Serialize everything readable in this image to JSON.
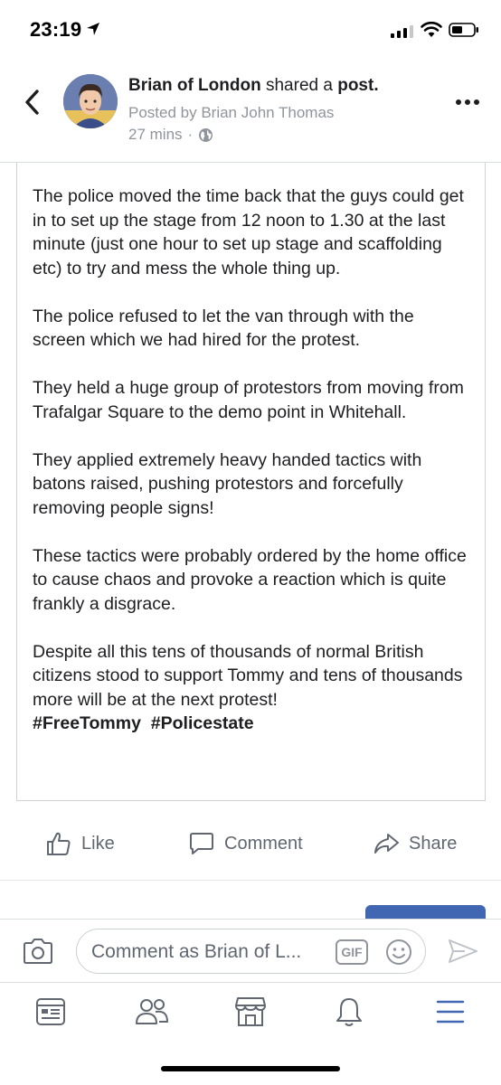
{
  "status_bar": {
    "time": "23:19"
  },
  "header": {
    "author": "Brian of London",
    "shared_text": "shared a",
    "post_word": "post.",
    "posted_by": "Posted by Brian John Thomas",
    "time_ago": "27 mins",
    "separator": "·",
    "privacy_icon": "globe-icon"
  },
  "post": {
    "paragraphs": [
      "The police moved the time back that the guys could get in to set up the stage from 12 noon to 1.30 at the last minute (just one hour to set up stage and scaffolding etc) to try and mess the whole thing up.",
      "The police refused to let the van through with the screen which we had hired for the protest.",
      "They held a huge group of protestors from moving from Trafalgar Square to the demo point in Whitehall.",
      "They applied extremely heavy handed tactics with batons raised, pushing protestors and forcefully removing people signs!",
      "These tactics were probably ordered by the home office to cause chaos and provoke a reaction which is quite frankly a disgrace.",
      "Despite all this tens of thousands of normal British citizens stood to support Tommy and tens of thousands more will be at the next protest!"
    ],
    "hashtags": [
      "#FreeTommy",
      "#Policestate"
    ]
  },
  "actions": {
    "like": "Like",
    "comment": "Comment",
    "share": "Share"
  },
  "comment_bar": {
    "placeholder": "Comment as Brian of L...",
    "gif": "GIF"
  },
  "tabs": [
    "news-feed-icon",
    "friends-icon",
    "marketplace-icon",
    "notifications-icon",
    "menu-icon"
  ],
  "colors": {
    "accent": "#4267b2",
    "text": "#1c1e21",
    "muted": "#90949c",
    "action": "#606770"
  }
}
